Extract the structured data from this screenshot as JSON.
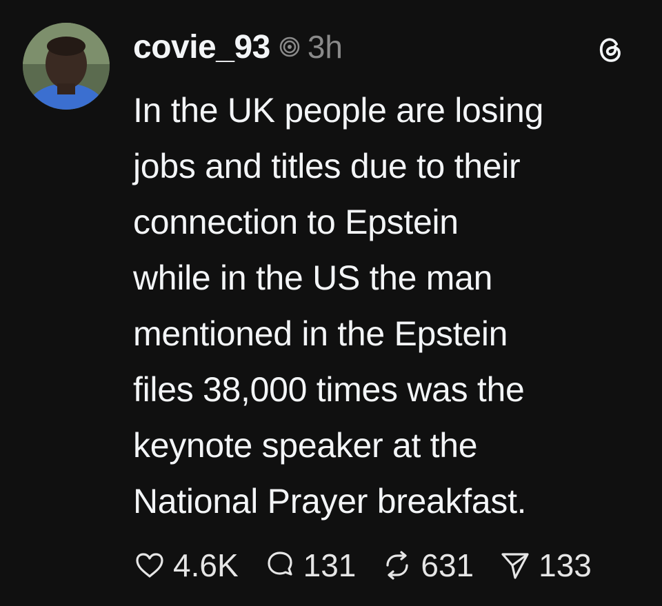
{
  "post": {
    "username": "covie_93",
    "timestamp": "3h",
    "text": "In the UK people are losing\njobs and titles due to their\nconnection to Epstein\nwhile in the US the man\nmentioned in the Epstein\nfiles 38,000 times was the\nkeynote speaker at the\nNational Prayer breakfast.",
    "icons": {
      "verified": "threads-verified-icon",
      "app": "threads-logo-icon"
    }
  },
  "actions": {
    "likes": {
      "icon": "heart-icon",
      "count": "4.6K"
    },
    "replies": {
      "icon": "comment-icon",
      "count": "131"
    },
    "reposts": {
      "icon": "repost-icon",
      "count": "631"
    },
    "shares": {
      "icon": "send-icon",
      "count": "133"
    }
  },
  "colors": {
    "background": "#101010",
    "text": "#f3f5f7",
    "muted": "#8a8a8a"
  }
}
